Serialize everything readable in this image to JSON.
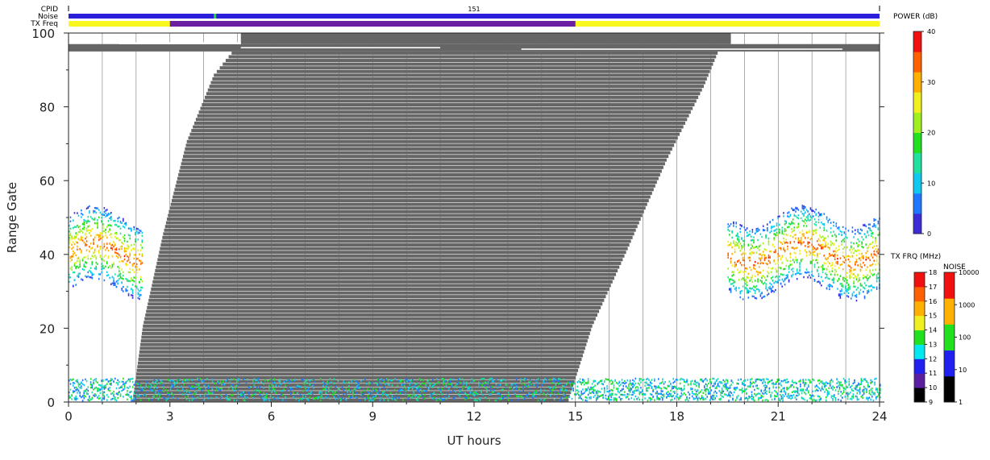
{
  "header": {
    "cpid_label": "CPID",
    "noise_label": "Noise",
    "txfreq_label": "TX Freq",
    "cpid_value": "151"
  },
  "chart_data": {
    "type": "heatmap",
    "title": "",
    "xlabel": "UT hours",
    "ylabel": "Range Gate",
    "xlim": [
      0,
      24
    ],
    "ylim": [
      0,
      100
    ],
    "x_ticks": [
      "0",
      "3",
      "6",
      "9",
      "12",
      "15",
      "18",
      "21",
      "24"
    ],
    "y_ticks": [
      "0",
      "20",
      "40",
      "60",
      "80",
      "100"
    ],
    "grid": "vertical lines every hour",
    "ground_scatter_region": {
      "color": "#666666",
      "left_edge": [
        [
          1.9,
          0
        ],
        [
          2.2,
          20
        ],
        [
          2.8,
          45
        ],
        [
          3.5,
          70
        ],
        [
          4.3,
          88
        ],
        [
          5.0,
          96
        ]
      ],
      "right_edge": [
        [
          14.8,
          0
        ],
        [
          15.5,
          20
        ],
        [
          16.5,
          40
        ],
        [
          17.7,
          65
        ],
        [
          18.8,
          85
        ],
        [
          19.3,
          96
        ]
      ],
      "top_rows": [
        {
          "gate_from": 95,
          "gate_to": 97,
          "start": 0,
          "end": 24
        },
        {
          "gate_from": 97,
          "gate_to": 100,
          "start": 5.1,
          "end": 19.6
        }
      ]
    },
    "echo_bands": [
      {
        "name": "morning",
        "start": 0,
        "end": 2.2,
        "gate_center": 40,
        "gate_width": 10
      },
      {
        "name": "evening",
        "start": 19.5,
        "end": 24,
        "gate_center": 40,
        "gate_width": 10
      },
      {
        "name": "near-range",
        "start": 0,
        "end": 24,
        "gate_center": 2,
        "gate_width": 4
      }
    ],
    "noise_spike_hour": 4.3,
    "txfreq_purple_span": [
      3,
      15
    ]
  },
  "power_scale": {
    "label": "POWER (dB)",
    "ticks": [
      "0",
      "10",
      "20",
      "30",
      "40"
    ],
    "colors": [
      "#3c2cd8",
      "#1e78ff",
      "#10c8f0",
      "#20e0a0",
      "#20e020",
      "#a0f020",
      "#f0f020",
      "#ffb000",
      "#ff6000",
      "#f01010"
    ]
  },
  "txfreq_scale": {
    "label": "TX FRQ (MHz)",
    "ticks": [
      "9",
      "10",
      "11",
      "12",
      "13",
      "14",
      "15",
      "16",
      "17",
      "18"
    ],
    "colors": [
      "#000000",
      "#5a1ea0",
      "#2020f0",
      "#00e8f0",
      "#20e020",
      "#f0f020",
      "#ffb000",
      "#ff6000",
      "#f01010"
    ]
  },
  "noise_scale": {
    "label": "NOISE",
    "ticks": [
      "1",
      "10",
      "100",
      "1000",
      "10000"
    ],
    "colors": [
      "#000000",
      "#2020f0",
      "#20e020",
      "#ffb000",
      "#f01010"
    ]
  }
}
